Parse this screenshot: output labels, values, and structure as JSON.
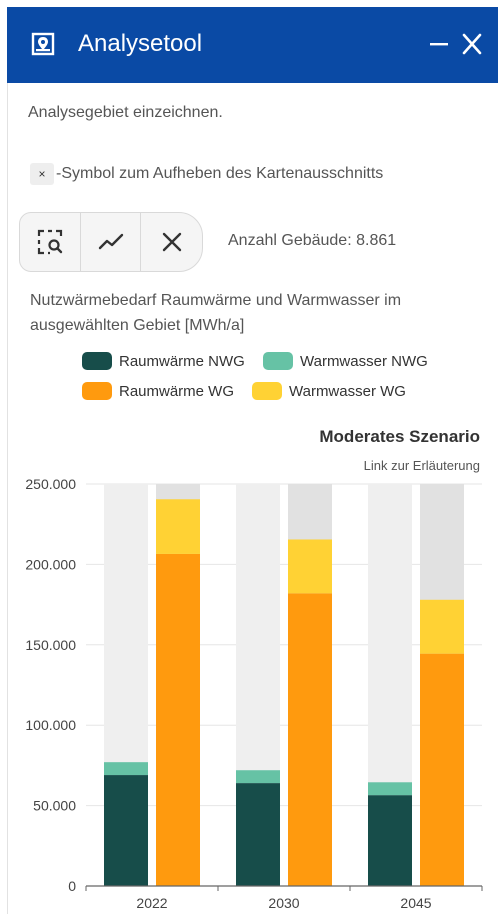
{
  "header": {
    "title": "Analysetool",
    "minimize_label": "–",
    "close_label": "✕",
    "background_color": "#0a4aa5",
    "logo_icon": "map-marker-icon"
  },
  "instructions": {
    "draw_hint": "Analysegebiet einzeichnen.",
    "clear_symbol": "×",
    "clear_hint": "-Symbol zum Aufheben des Kartenausschnitts"
  },
  "toolbar": {
    "tools": [
      {
        "icon": "zoom-select-icon"
      },
      {
        "icon": "line-chart-icon"
      },
      {
        "icon": "close-icon"
      }
    ]
  },
  "building_count": {
    "label": "Anzahl Gebäude:",
    "value": "8.861"
  },
  "chart_description": "Nutzwärmebedarf Raumwärme und Warmwasser im ausgewählten Gebiet [MWh/a]",
  "chart_data": {
    "type": "bar",
    "title": "Moderates Szenario",
    "link": "Link zur Erläuterung",
    "categories": [
      "2022",
      "2030",
      "2045"
    ],
    "ylim": [
      0,
      250000
    ],
    "yticks": [
      "0",
      "50.000",
      "100.000",
      "150.000",
      "200.000",
      "250.000"
    ],
    "yticks_values": [
      0,
      50000,
      100000,
      150000,
      200000,
      250000
    ],
    "stacks": [
      {
        "stack": "NWG",
        "series": [
          {
            "name": "Raumwärme NWG",
            "color": "#174d4a",
            "values": [
              69000,
              64000,
              56500
            ]
          },
          {
            "name": "Warmwasser NWG",
            "color": "#66c2a5",
            "values": [
              8000,
              8000,
              8000
            ]
          }
        ],
        "background_color": "#efefef"
      },
      {
        "stack": "WG",
        "series": [
          {
            "name": "Raumwärme WG",
            "color": "#ff9a0e",
            "values": [
              206500,
              182000,
              144500
            ]
          },
          {
            "name": "Warmwasser WG",
            "color": "#ffd234",
            "values": [
              34000,
              33500,
              33500
            ]
          }
        ],
        "background_color": "#e1e1e1"
      }
    ],
    "legend": [
      {
        "name": "Raumwärme NWG",
        "color": "#174d4a"
      },
      {
        "name": "Warmwasser NWG",
        "color": "#66c2a5"
      },
      {
        "name": "Raumwärme WG",
        "color": "#ff9a0e"
      },
      {
        "name": "Warmwasser WG",
        "color": "#ffd234"
      }
    ],
    "legend_position": "top",
    "grid": true
  }
}
